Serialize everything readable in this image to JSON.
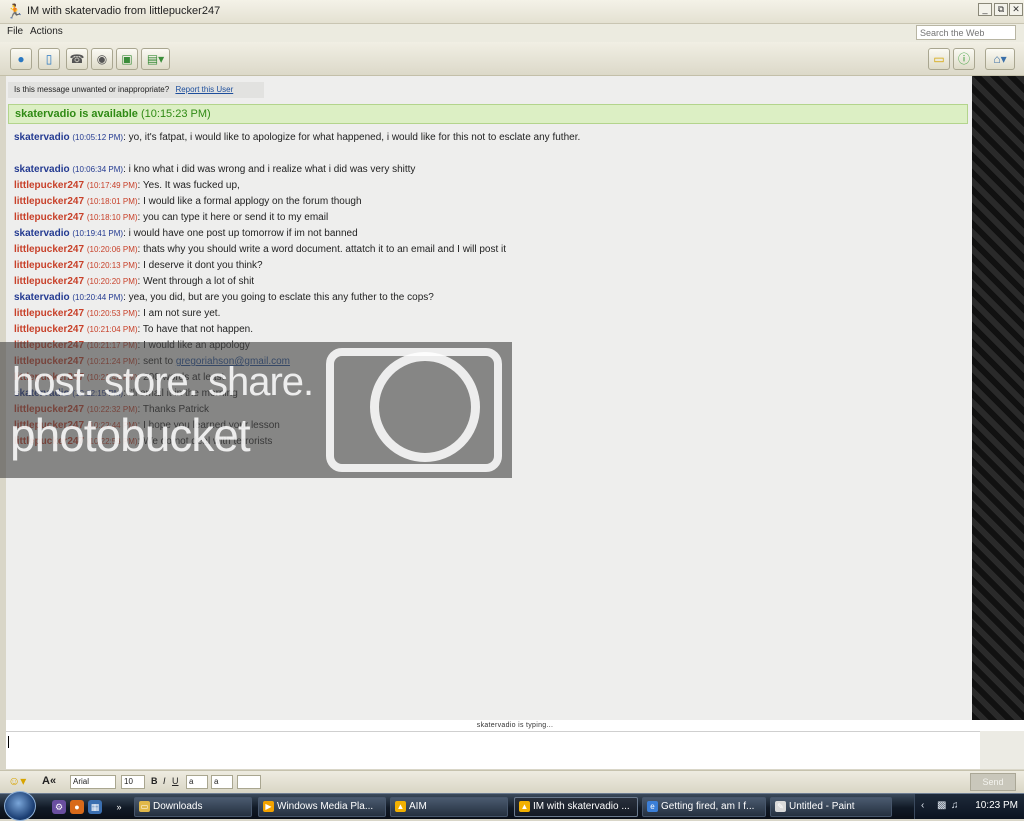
{
  "window": {
    "title": "IM with skatervadio from littlepucker247"
  },
  "menu": {
    "file": "File",
    "actions": "Actions",
    "search_placeholder": "Search the Web"
  },
  "colors": {
    "buddy_blue": "#233a91",
    "self_red": "#c8412a",
    "status_green": "#2f8a14"
  },
  "icons": {
    "toolbar": [
      "buddy-info-icon",
      "phone-mobile-icon",
      "phone-call-icon",
      "webcam-icon",
      "image-icon",
      "file-transfer-icon"
    ],
    "toolbar_right": [
      "folder-icon",
      "info-icon",
      "home-icon"
    ]
  },
  "warning": {
    "text": "Is this message unwanted or inappropriate?",
    "link": "Report this User"
  },
  "status": {
    "name_text": "skatervadio is available",
    "time": "(10:15:23 PM)"
  },
  "messages": [
    {
      "sn": "skatervadio",
      "time": "(10:05:12 PM)",
      "text": ": yo, it's fatpat, i would like to apologize for what happened, i would like for this not to esclate any futher.",
      "side": "blue"
    },
    {
      "sn": "skatervadio",
      "time": "(10:06:34 PM)",
      "text": ": i kno what i did was wrong and i realize what i did was very shitty",
      "side": "blue"
    },
    {
      "sn": "littlepucker247",
      "time": "(10:17:49 PM)",
      "text": ": Yes. It was fucked up,",
      "side": "red"
    },
    {
      "sn": "littlepucker247",
      "time": "(10:18:01 PM)",
      "text": ": I would like a formal applogy on the forum though",
      "side": "red"
    },
    {
      "sn": "littlepucker247",
      "time": "(10:18:10 PM)",
      "text": ": you can type it here or send it to my email",
      "side": "red"
    },
    {
      "sn": "skatervadio",
      "time": "(10:19:41 PM)",
      "text": ": i would have one post up tomorrow if im not banned",
      "side": "blue"
    },
    {
      "sn": "littlepucker247",
      "time": "(10:20:06 PM)",
      "text": ": thats why you should write a word document. attatch it to an email and I will post it",
      "side": "red"
    },
    {
      "sn": "littlepucker247",
      "time": "(10:20:13 PM)",
      "text": ": I deserve it dont you think?",
      "side": "red"
    },
    {
      "sn": "littlepucker247",
      "time": "(10:20:20 PM)",
      "text": ": Went through a lot of shit",
      "side": "red"
    },
    {
      "sn": "skatervadio",
      "time": "(10:20:44 PM)",
      "text": ": yea, you did, but are you going to esclate this any futher to the cops?",
      "side": "blue"
    },
    {
      "sn": "littlepucker247",
      "time": "(10:20:53 PM)",
      "text": ": I am not sure yet.",
      "side": "red"
    },
    {
      "sn": "littlepucker247",
      "time": "(10:21:04 PM)",
      "text": ": To have that not happen.",
      "side": "red"
    },
    {
      "sn": "littlepucker247",
      "time": "(10:21:17 PM)",
      "text": ": I would like an appology",
      "side": "red"
    },
    {
      "sn": "littlepucker247",
      "time": "(10:21:24 PM)",
      "text": ": sent to ",
      "link": "gregoriahson@gmail.com",
      "side": "red"
    },
    {
      "sn": "littlepucker247",
      "time": "(10:21:42 PM)",
      "text": ": 200 words at least",
      "side": "red"
    },
    {
      "sn": "skatervadio",
      "time": "(10:22:15 PM)",
      "text": ": i'll email it in the morning",
      "side": "blue"
    },
    {
      "sn": "littlepucker247",
      "time": "(10:22:32 PM)",
      "text": ": Thanks Patrick",
      "side": "red"
    },
    {
      "sn": "littlepucker247",
      "time": "(10:22:44 PM)",
      "text": ": I hope you learned your lesson",
      "side": "red"
    },
    {
      "sn": "littlepucker247",
      "time": "(10:22:58 PM)",
      "text": ": We do not deal with terrorists",
      "side": "red"
    }
  ],
  "watermark": {
    "line1": "host. store. share.",
    "line2": "photobucket"
  },
  "typing_status": "skatervadio is typing...",
  "format": {
    "font": "Arial",
    "size": "10",
    "bold": "B",
    "italic": "I",
    "underline": "U",
    "text_color": "a",
    "bg_color": "a",
    "send": "Send"
  },
  "taskbar": {
    "tasks": [
      "Downloads",
      "Windows Media Pla...",
      "AIM",
      "IM with skatervadio ...",
      "Getting fired, am I f...",
      "Untitled - Paint"
    ],
    "active_index": 3,
    "clock": "10:23 PM"
  }
}
